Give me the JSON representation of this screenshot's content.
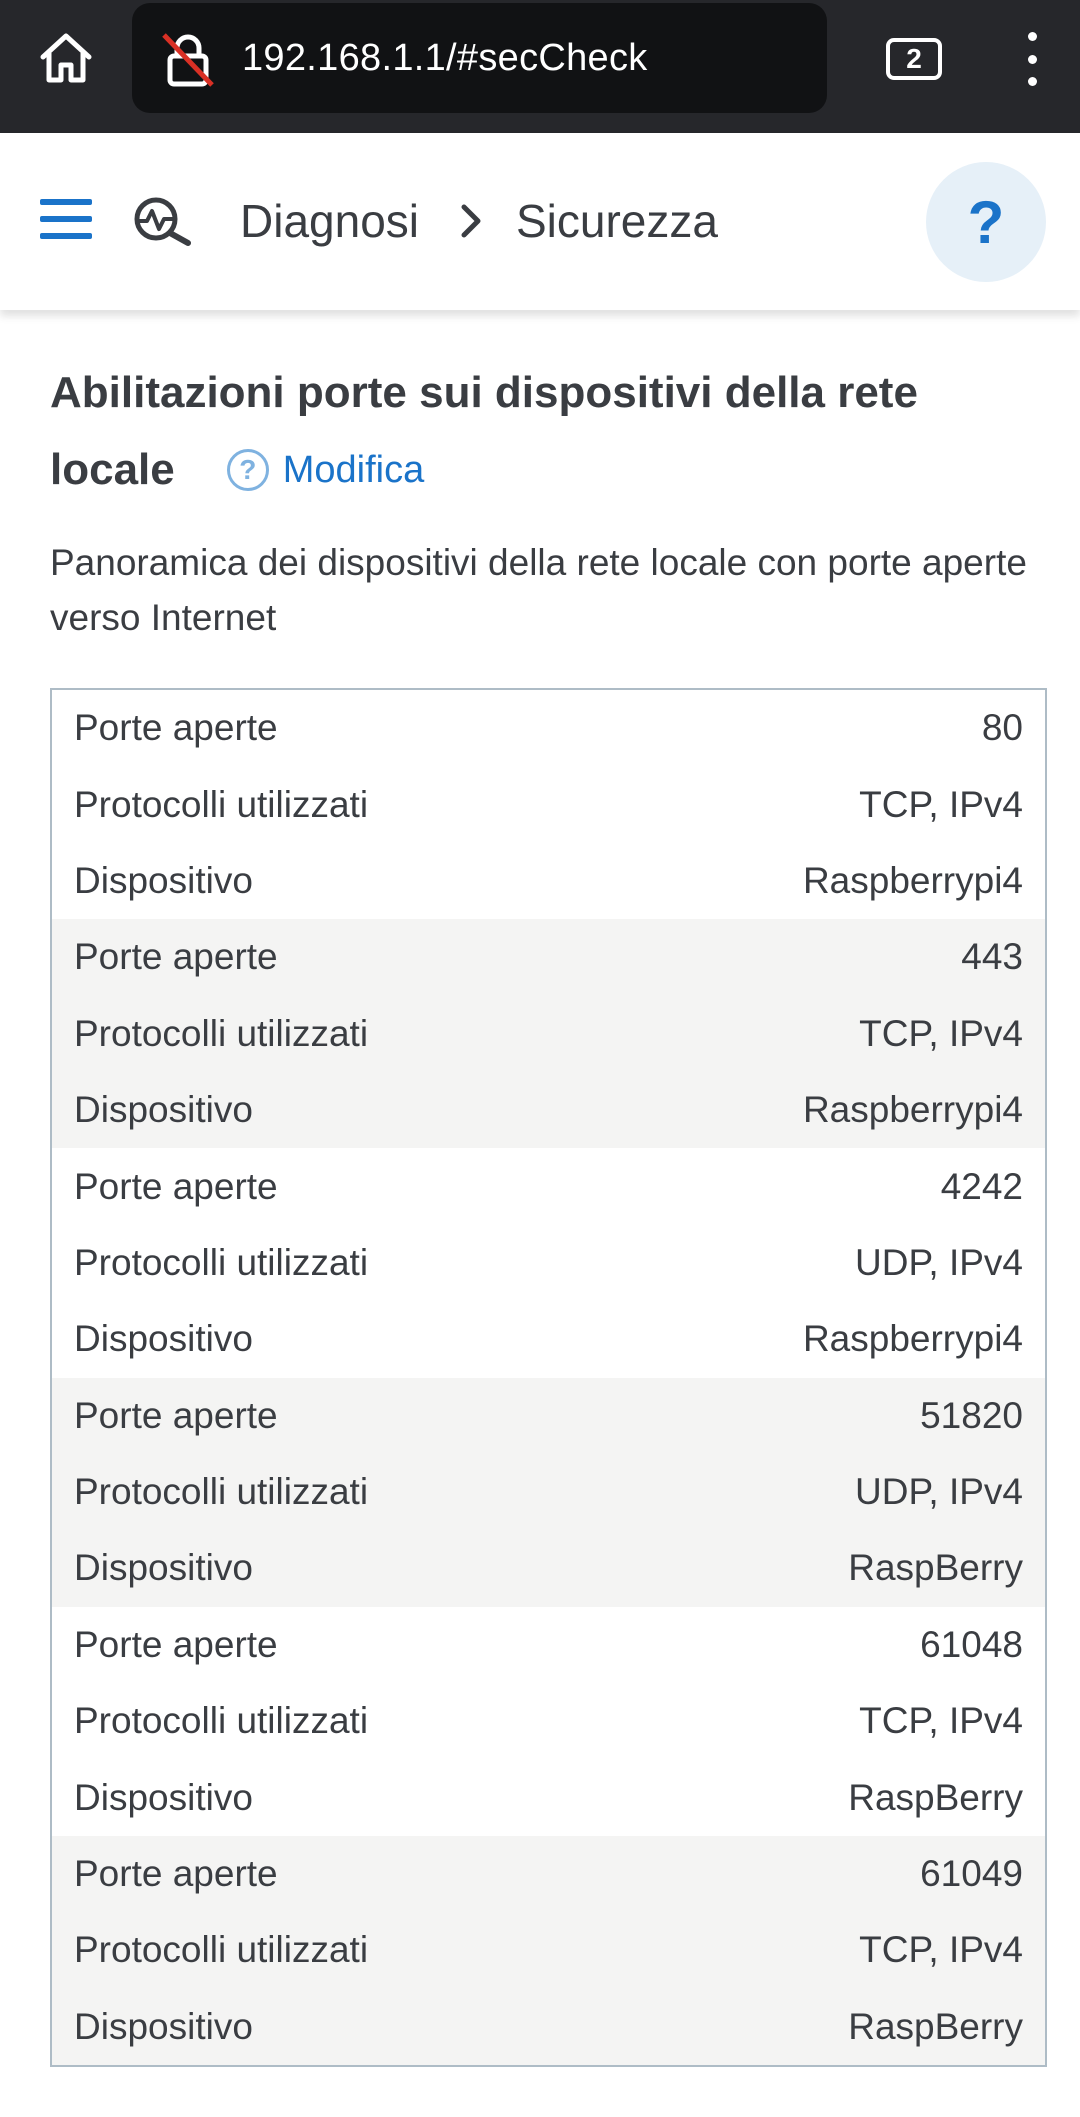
{
  "browser": {
    "url": "192.168.1.1/#secCheck",
    "tab_count": "2",
    "icons": {
      "home": "home-icon",
      "lock": "insecure-lock-icon",
      "menu": "more-vert-icon"
    }
  },
  "header": {
    "breadcrumb": [
      "Diagnosi",
      "Sicurezza"
    ],
    "help_label": "?",
    "accent_color": "#1a73c9"
  },
  "section": {
    "title_line1": "Abilitazioni porte sui dispositivi della rete",
    "title_line2": "locale",
    "edit_label": "Modifica",
    "description": "Panoramica dei dispositivi della rete locale con porte aperte verso Internet"
  },
  "labels": {
    "port": "Porte aperte",
    "protocol": "Protocolli utilizzati",
    "device": "Dispositivo"
  },
  "entries": [
    {
      "port": "80",
      "protocol": "TCP, IPv4",
      "device": "Raspberrypi4"
    },
    {
      "port": "443",
      "protocol": "TCP, IPv4",
      "device": "Raspberrypi4"
    },
    {
      "port": "4242",
      "protocol": "UDP, IPv4",
      "device": "Raspberrypi4"
    },
    {
      "port": "51820",
      "protocol": "UDP, IPv4",
      "device": "RaspBerry"
    },
    {
      "port": "61048",
      "protocol": "TCP, IPv4",
      "device": "RaspBerry"
    },
    {
      "port": "61049",
      "protocol": "TCP, IPv4",
      "device": "RaspBerry"
    }
  ]
}
